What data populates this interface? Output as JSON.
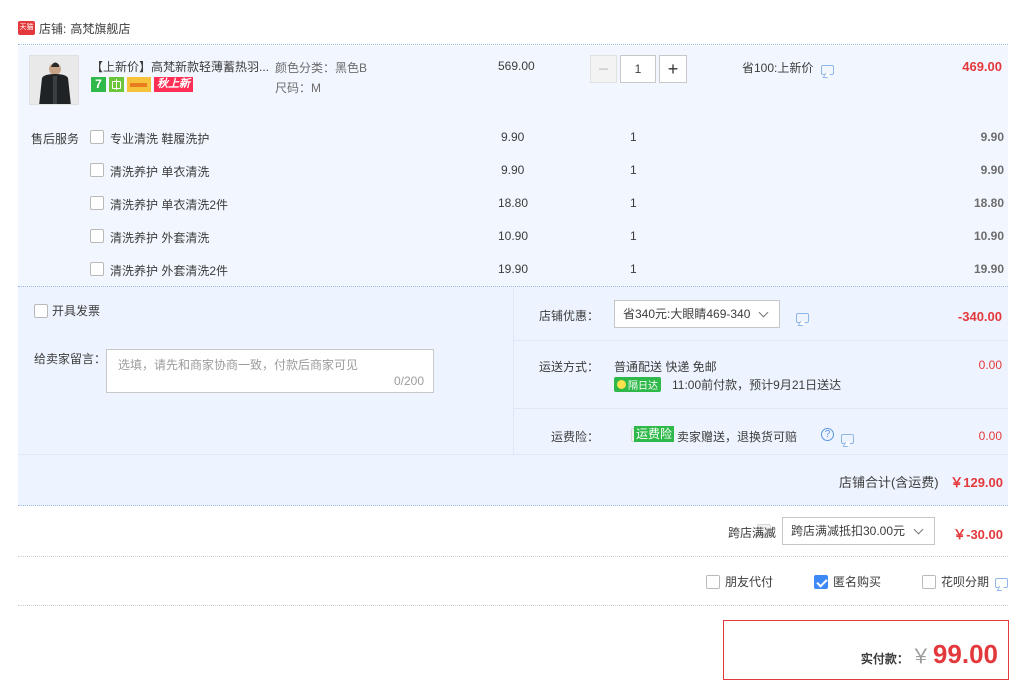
{
  "shop": {
    "badge": "天猫",
    "label": "店铺:",
    "name": "高梵旗舰店"
  },
  "product": {
    "title": "【上新价】高梵新款轻薄蓄热羽...",
    "color_attr": "颜色分类：黑色B",
    "size_attr": "尺码：M",
    "unit_price": "569.00",
    "quantity": "1",
    "discount_note": "省100:上新价",
    "total": "469.00",
    "badges": {
      "seven_day": "7",
      "new_tag": "秋上新"
    }
  },
  "after_sales": {
    "label": "售后服务",
    "items": [
      {
        "name": "专业清洗 鞋履洗护",
        "price": "9.90",
        "qty": "1",
        "total": "9.90"
      },
      {
        "name": "清洗养护 单衣清洗",
        "price": "9.90",
        "qty": "1",
        "total": "9.90"
      },
      {
        "name": "清洗养护 单衣清洗2件",
        "price": "18.80",
        "qty": "1",
        "total": "18.80"
      },
      {
        "name": "清洗养护 外套清洗",
        "price": "10.90",
        "qty": "1",
        "total": "10.90"
      },
      {
        "name": "清洗养护 外套清洗2件",
        "price": "19.90",
        "qty": "1",
        "total": "19.90"
      }
    ]
  },
  "invoice": {
    "label": "开具发票"
  },
  "message": {
    "label": "给卖家留言：",
    "placeholder": "选填，请先和商家协商一致，付款后商家可见",
    "counter": "0/200"
  },
  "shop_discount": {
    "label": "店铺优惠：",
    "selected": "省340元:大眼睛469-340",
    "amount": "-340.00"
  },
  "shipping": {
    "label": "运送方式：",
    "method": "普通配送 快递 免邮",
    "tag": "隔日达",
    "eta": "11:00前付款，预计9月21日送达",
    "amount": "0.00"
  },
  "insurance": {
    "label": "运费险：",
    "tag": "运费险",
    "desc": "卖家赠送，退换货可赔",
    "amount": "0.00"
  },
  "shop_total": {
    "label": "店铺合计(含运费)",
    "amount": "￥129.00"
  },
  "cross_store": {
    "label": "跨店满减",
    "selected": "跨店满减抵扣30.00元",
    "amount": "￥-30.00"
  },
  "options": {
    "friend_pay": "朋友代付",
    "anonymous": "匿名购买",
    "huabei": "花呗分期"
  },
  "payment": {
    "label": "实付款：",
    "currency": "￥",
    "amount": "99.00"
  },
  "colors": {
    "accent": "#e4393c",
    "panel": "#eef4ff",
    "checked": "#3d8af7"
  }
}
